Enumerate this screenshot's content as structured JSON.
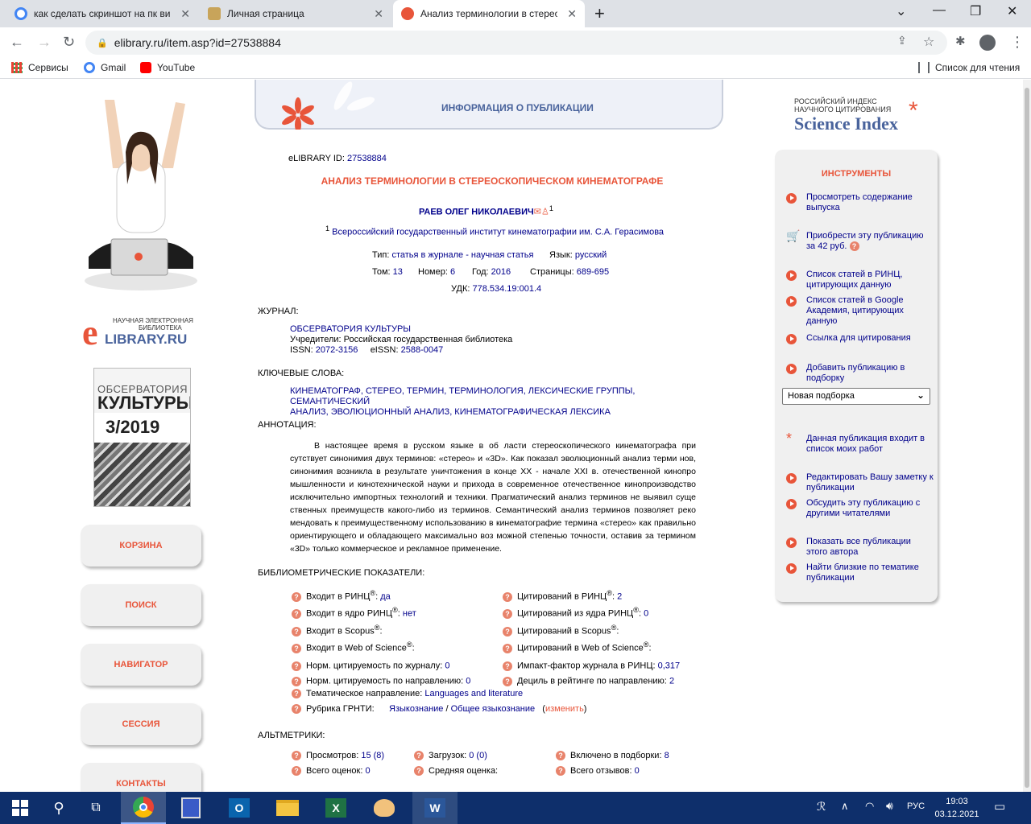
{
  "browser": {
    "tabs": [
      {
        "title": "как сделать скриншот на пк вин"
      },
      {
        "title": "Личная страница"
      },
      {
        "title": "Анализ терминологии в стерео"
      }
    ],
    "url": "elibrary.ru/item.asp?id=27538884",
    "bookmarks": [
      "Сервисы",
      "Gmail",
      "YouTube"
    ],
    "reading_list": "Список для чтения"
  },
  "sidebar_left": {
    "logo_line1": "НАУЧНАЯ ЭЛЕКТРОННАЯ",
    "logo_line2": "БИБЛИОТЕКА",
    "logo_brand": "LIBRARY.RU",
    "cover_title1": "ОБСЕРВАТОРИЯ",
    "cover_title2": "КУЛЬТУРЫ",
    "cover_issue": "3/2019",
    "nav": [
      "КОРЗИНА",
      "ПОИСК",
      "НАВИГАТОР",
      "СЕССИЯ",
      "КОНТАКТЫ"
    ]
  },
  "header": {
    "title": "ИНФОРМАЦИЯ О ПУБЛИКАЦИИ"
  },
  "publication": {
    "id_label": "eLIBRARY ID:",
    "id_value": "27538884",
    "title": "АНАЛИЗ ТЕРМИНОЛОГИИ В СТЕРЕОСКОПИЧЕСКОМ КИНЕМАТОГРАФЕ",
    "author": "РАЕВ ОЛЕГ НИКОЛАЕВИЧ",
    "author_sup": "1",
    "affiliation_sup": "1",
    "affiliation": "Всероссийский государственный институт кинематографии им. С.А. Герасимова",
    "type_label": "Тип:",
    "type_value": "статья в журнале - научная статья",
    "lang_label": "Язык:",
    "lang_value": "русский",
    "volume_label": "Том:",
    "volume_value": "13",
    "number_label": "Номер:",
    "number_value": "6",
    "year_label": "Год:",
    "year_value": "2016",
    "pages_label": "Страницы:",
    "pages_value": "689-695",
    "udk_label": "УДК:",
    "udk_value": "778.534.19:001.4"
  },
  "journal": {
    "heading": "ЖУРНАЛ:",
    "name": "ОБСЕРВАТОРИЯ КУЛЬТУРЫ",
    "founder_label": "Учредители:",
    "founder_value": "Российская государственная библиотека",
    "issn_label": "ISSN:",
    "issn_value": "2072-3156",
    "eissn_label": "eISSN:",
    "eissn_value": "2588-0047"
  },
  "keywords": {
    "heading": "КЛЮЧЕВЫЕ СЛОВА:",
    "line1": "КИНЕМАТОГРАФ, СТЕРЕО, ТЕРМИН, ТЕРМИНОЛОГИЯ, ЛЕКСИЧЕСКИЕ ГРУППЫ, СЕМАНТИЧЕСКИЙ",
    "line2": "АНАЛИЗ, ЭВОЛЮЦИОННЫЙ АНАЛИЗ, КИНЕМАТОГРАФИЧЕСКАЯ ЛЕКСИКА"
  },
  "abstract": {
    "heading": "АННОТАЦИЯ:",
    "text": "В настоящее время в русском языке в об ласти стереоскопического кинематографа при сутствует синонимия двух терминов: «стерео» и «3D». Как показал эволюционный анализ терми нов, синонимия возникла в результате уничтожения в конце XX - начале XXI в. отечественной кинопро мышленности и кинотехнической науки и прихода в современное отечественное кинопроизводство исключительно импортных технологий и техники. Прагматический анализ терминов не выявил суще ственных преимуществ какого-либо из терминов. Семантический анализ терминов позволяет реко мендовать к преимущественному использованию в кинематографие термина «стерео» как правильно ориентирующего и обладающего максимально воз можной степенью точности, оставив за термином «3D» только коммерческое и рекламное применение."
  },
  "bibliometrics": {
    "heading": "БИБЛИОМЕТРИЧЕСКИЕ ПОКАЗАТЕЛИ:",
    "left": [
      {
        "label": "Входит в РИНЦ",
        "sup": "®",
        "sep": ": ",
        "value": "да"
      },
      {
        "label": "Входит в ядро РИНЦ",
        "sup": "®",
        "sep": ": ",
        "value": "нет"
      },
      {
        "label": "Входит в Scopus",
        "sup": "®",
        "sep": ":",
        "value": ""
      },
      {
        "label": "Входит в Web of Science",
        "sup": "®",
        "sep": ":",
        "value": ""
      },
      {
        "label": "Норм. цитируемость по журналу:",
        "sup": "",
        "sep": " ",
        "value": "0"
      },
      {
        "label": "Норм. цитируемость по направлению:",
        "sup": "",
        "sep": " ",
        "value": "0"
      }
    ],
    "right": [
      {
        "label": "Цитирований в РИНЦ",
        "sup": "®",
        "sep": ": ",
        "value": "2"
      },
      {
        "label": "Цитирований из ядра РИНЦ",
        "sup": "®",
        "sep": ": ",
        "value": "0"
      },
      {
        "label": "Цитирований в Scopus",
        "sup": "®",
        "sep": ":",
        "value": ""
      },
      {
        "label": "Цитирований в Web of Science",
        "sup": "®",
        "sep": ":",
        "value": ""
      },
      {
        "label": "Импакт-фактор журнала в РИНЦ:",
        "sup": "",
        "sep": " ",
        "value": "0,317"
      },
      {
        "label": "Дециль в рейтинге по направлению:",
        "sup": "",
        "sep": " ",
        "value": "2"
      }
    ],
    "direction_label": "Тематическое направление:",
    "direction_value": "Languages and literature",
    "grnti_label": "Рубрика ГРНТИ:",
    "grnti_value1": "Языкознание",
    "grnti_sep": "/",
    "grnti_value2": "Общее языкознание",
    "grnti_change": "изменить"
  },
  "altmetrics": {
    "heading": "АЛЬТМЕТРИКИ:",
    "views_label": "Просмотров:",
    "views_value": "15 (8)",
    "downloads_label": "Загрузок:",
    "downloads_value": "0 (0)",
    "collections_label": "Включено в подборки:",
    "collections_value": "8",
    "ratings_label": "Всего оценок:",
    "ratings_value": "0",
    "avg_label": "Средняя оценка:",
    "avg_value": "",
    "reviews_label": "Всего отзывов:",
    "reviews_value": "0"
  },
  "science_index": {
    "line1": "РОССИЙСКИЙ ИНДЕКС",
    "line2": "НАУЧНОГО ЦИТИРОВАНИЯ",
    "brand": "Science Index"
  },
  "tools": {
    "heading": "ИНСТРУМЕНТЫ",
    "items": [
      {
        "l1": "Просмотреть содержание",
        "l2": "выпуска"
      },
      {
        "l1": "Приобрести эту публикацию",
        "l2": "за 42 руб."
      },
      {
        "l1": "Список статей в РИНЦ,",
        "l2": "цитирующих данную"
      },
      {
        "l1": "Список статей в Google",
        "l2": "Академия, цитирующих",
        "l3": "данную"
      },
      {
        "l1": "Ссылка для цитирования",
        "l2": ""
      },
      {
        "l1": "Добавить публикацию в",
        "l2": "подборку"
      },
      {
        "l1": "Данная публикация входит в",
        "l2": "список моих работ"
      },
      {
        "l1": "Редактировать Вашу заметку к",
        "l2": "публикации"
      },
      {
        "l1": "Обсудить эту публикацию с",
        "l2": "другими читателями"
      },
      {
        "l1": "Показать все публикации",
        "l2": "этого автора"
      },
      {
        "l1": "Найти близкие по тематике",
        "l2": "публикации"
      }
    ],
    "select_value": "Новая подборка"
  },
  "taskbar": {
    "lang": "РУС",
    "time": "19:03",
    "date": "03.12.2021"
  },
  "colors": {
    "accent": "#e8553a",
    "link": "#00008b",
    "header_text": "#49639c",
    "taskbar": "#0e2f6b"
  }
}
